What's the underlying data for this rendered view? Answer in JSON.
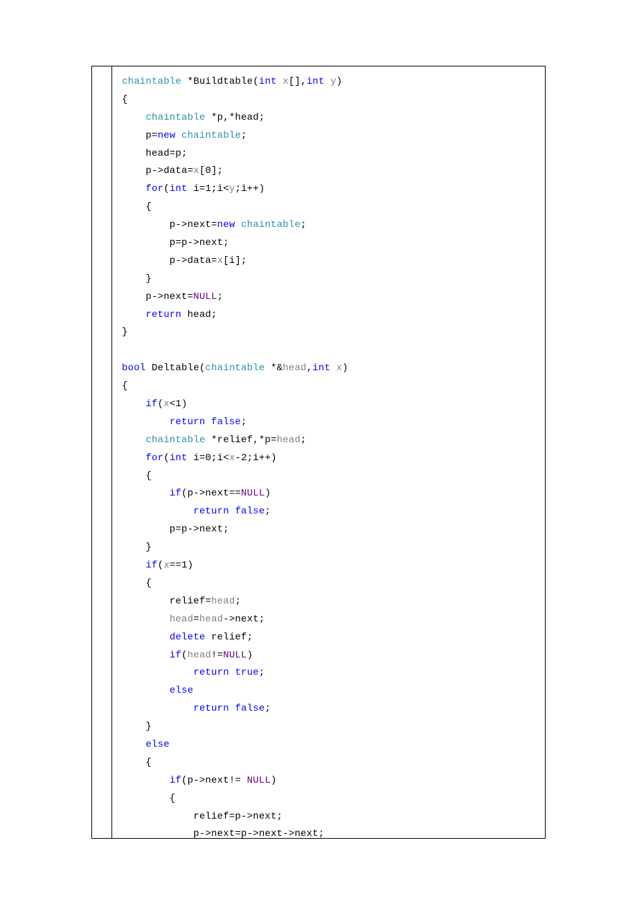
{
  "code": {
    "tokens": [
      {
        "cls": "t-type",
        "text": "chaintable"
      },
      {
        "cls": "",
        "text": " *Buildtable("
      },
      {
        "cls": "t-kw",
        "text": "int"
      },
      {
        "cls": "",
        "text": " "
      },
      {
        "cls": "t-param",
        "text": "x"
      },
      {
        "cls": "",
        "text": "[],"
      },
      {
        "cls": "t-kw",
        "text": "int"
      },
      {
        "cls": "",
        "text": " "
      },
      {
        "cls": "t-param",
        "text": "y"
      },
      {
        "cls": "",
        "text": ")"
      },
      {
        "nl": true
      },
      {
        "cls": "",
        "text": "{"
      },
      {
        "nl": true
      },
      {
        "cls": "",
        "text": "    "
      },
      {
        "cls": "t-type",
        "text": "chaintable"
      },
      {
        "cls": "",
        "text": " *p,*head;"
      },
      {
        "nl": true
      },
      {
        "cls": "",
        "text": "    p="
      },
      {
        "cls": "t-kw",
        "text": "new"
      },
      {
        "cls": "",
        "text": " "
      },
      {
        "cls": "t-type",
        "text": "chaintable"
      },
      {
        "cls": "",
        "text": ";"
      },
      {
        "nl": true
      },
      {
        "cls": "",
        "text": "    head=p;"
      },
      {
        "nl": true
      },
      {
        "cls": "",
        "text": "    p->data="
      },
      {
        "cls": "t-param",
        "text": "x"
      },
      {
        "cls": "",
        "text": "[0];"
      },
      {
        "nl": true
      },
      {
        "cls": "",
        "text": "    "
      },
      {
        "cls": "t-kw",
        "text": "for"
      },
      {
        "cls": "",
        "text": "("
      },
      {
        "cls": "t-kw",
        "text": "int"
      },
      {
        "cls": "",
        "text": " i=1;i<"
      },
      {
        "cls": "t-param",
        "text": "y"
      },
      {
        "cls": "",
        "text": ";i++)"
      },
      {
        "nl": true
      },
      {
        "cls": "",
        "text": "    {"
      },
      {
        "nl": true
      },
      {
        "cls": "",
        "text": "        p->next="
      },
      {
        "cls": "t-kw",
        "text": "new"
      },
      {
        "cls": "",
        "text": " "
      },
      {
        "cls": "t-type",
        "text": "chaintable"
      },
      {
        "cls": "",
        "text": ";"
      },
      {
        "nl": true
      },
      {
        "cls": "",
        "text": "        p=p->next;"
      },
      {
        "nl": true
      },
      {
        "cls": "",
        "text": "        p->data="
      },
      {
        "cls": "t-param",
        "text": "x"
      },
      {
        "cls": "",
        "text": "[i];"
      },
      {
        "nl": true
      },
      {
        "cls": "",
        "text": "    }"
      },
      {
        "nl": true
      },
      {
        "cls": "",
        "text": "    p->next="
      },
      {
        "cls": "t-null",
        "text": "NULL"
      },
      {
        "cls": "",
        "text": ";"
      },
      {
        "nl": true
      },
      {
        "cls": "",
        "text": "    "
      },
      {
        "cls": "t-kw",
        "text": "return"
      },
      {
        "cls": "",
        "text": " head;"
      },
      {
        "nl": true
      },
      {
        "cls": "",
        "text": "}"
      },
      {
        "nl": true
      },
      {
        "nl": true
      },
      {
        "cls": "t-kw",
        "text": "bool"
      },
      {
        "cls": "",
        "text": " Deltable("
      },
      {
        "cls": "t-type",
        "text": "chaintable"
      },
      {
        "cls": "",
        "text": " *&"
      },
      {
        "cls": "t-param",
        "text": "head"
      },
      {
        "cls": "",
        "text": ","
      },
      {
        "cls": "t-kw",
        "text": "int"
      },
      {
        "cls": "",
        "text": " "
      },
      {
        "cls": "t-param",
        "text": "x"
      },
      {
        "cls": "",
        "text": ")"
      },
      {
        "nl": true
      },
      {
        "cls": "",
        "text": "{"
      },
      {
        "nl": true
      },
      {
        "cls": "",
        "text": "    "
      },
      {
        "cls": "t-kw",
        "text": "if"
      },
      {
        "cls": "",
        "text": "("
      },
      {
        "cls": "t-param",
        "text": "x"
      },
      {
        "cls": "",
        "text": "<1)"
      },
      {
        "nl": true
      },
      {
        "cls": "",
        "text": "        "
      },
      {
        "cls": "t-kw",
        "text": "return"
      },
      {
        "cls": "",
        "text": " "
      },
      {
        "cls": "t-kw",
        "text": "false"
      },
      {
        "cls": "",
        "text": ";"
      },
      {
        "nl": true
      },
      {
        "cls": "",
        "text": "    "
      },
      {
        "cls": "t-type",
        "text": "chaintable"
      },
      {
        "cls": "",
        "text": " *relief,*p="
      },
      {
        "cls": "t-param",
        "text": "head"
      },
      {
        "cls": "",
        "text": ";"
      },
      {
        "nl": true
      },
      {
        "cls": "",
        "text": "    "
      },
      {
        "cls": "t-kw",
        "text": "for"
      },
      {
        "cls": "",
        "text": "("
      },
      {
        "cls": "t-kw",
        "text": "int"
      },
      {
        "cls": "",
        "text": " i=0;i<"
      },
      {
        "cls": "t-param",
        "text": "x"
      },
      {
        "cls": "",
        "text": "-2;i++)"
      },
      {
        "nl": true
      },
      {
        "cls": "",
        "text": "    {"
      },
      {
        "nl": true
      },
      {
        "cls": "",
        "text": "        "
      },
      {
        "cls": "t-kw",
        "text": "if"
      },
      {
        "cls": "",
        "text": "(p->next=="
      },
      {
        "cls": "t-null",
        "text": "NULL"
      },
      {
        "cls": "",
        "text": ")"
      },
      {
        "nl": true
      },
      {
        "cls": "",
        "text": "            "
      },
      {
        "cls": "t-kw",
        "text": "return"
      },
      {
        "cls": "",
        "text": " "
      },
      {
        "cls": "t-kw",
        "text": "false"
      },
      {
        "cls": "",
        "text": ";"
      },
      {
        "nl": true
      },
      {
        "cls": "",
        "text": "        p=p->next;"
      },
      {
        "nl": true
      },
      {
        "cls": "",
        "text": "    }"
      },
      {
        "nl": true
      },
      {
        "cls": "",
        "text": "    "
      },
      {
        "cls": "t-kw",
        "text": "if"
      },
      {
        "cls": "",
        "text": "("
      },
      {
        "cls": "t-param",
        "text": "x"
      },
      {
        "cls": "",
        "text": "==1)"
      },
      {
        "nl": true
      },
      {
        "cls": "",
        "text": "    {"
      },
      {
        "nl": true
      },
      {
        "cls": "",
        "text": "        relief="
      },
      {
        "cls": "t-param",
        "text": "head"
      },
      {
        "cls": "",
        "text": ";"
      },
      {
        "nl": true
      },
      {
        "cls": "",
        "text": "        "
      },
      {
        "cls": "t-param",
        "text": "head"
      },
      {
        "cls": "",
        "text": "="
      },
      {
        "cls": "t-param",
        "text": "head"
      },
      {
        "cls": "",
        "text": "->next;"
      },
      {
        "nl": true
      },
      {
        "cls": "",
        "text": "        "
      },
      {
        "cls": "t-kw",
        "text": "delete"
      },
      {
        "cls": "",
        "text": " relief;"
      },
      {
        "nl": true
      },
      {
        "cls": "",
        "text": "        "
      },
      {
        "cls": "t-kw",
        "text": "if"
      },
      {
        "cls": "",
        "text": "("
      },
      {
        "cls": "t-param",
        "text": "head"
      },
      {
        "cls": "",
        "text": "!="
      },
      {
        "cls": "t-null",
        "text": "NULL"
      },
      {
        "cls": "",
        "text": ")"
      },
      {
        "nl": true
      },
      {
        "cls": "",
        "text": "            "
      },
      {
        "cls": "t-kw",
        "text": "return"
      },
      {
        "cls": "",
        "text": " "
      },
      {
        "cls": "t-kw",
        "text": "true"
      },
      {
        "cls": "",
        "text": ";"
      },
      {
        "nl": true
      },
      {
        "cls": "",
        "text": "        "
      },
      {
        "cls": "t-kw",
        "text": "else"
      },
      {
        "nl": true
      },
      {
        "cls": "",
        "text": "            "
      },
      {
        "cls": "t-kw",
        "text": "return"
      },
      {
        "cls": "",
        "text": " "
      },
      {
        "cls": "t-kw",
        "text": "false"
      },
      {
        "cls": "",
        "text": ";"
      },
      {
        "nl": true
      },
      {
        "cls": "",
        "text": "    }"
      },
      {
        "nl": true
      },
      {
        "cls": "",
        "text": "    "
      },
      {
        "cls": "t-kw",
        "text": "else"
      },
      {
        "nl": true
      },
      {
        "cls": "",
        "text": "    {"
      },
      {
        "nl": true
      },
      {
        "cls": "",
        "text": "        "
      },
      {
        "cls": "t-kw",
        "text": "if"
      },
      {
        "cls": "",
        "text": "(p->next!= "
      },
      {
        "cls": "t-null",
        "text": "NULL"
      },
      {
        "cls": "",
        "text": ")"
      },
      {
        "nl": true
      },
      {
        "cls": "",
        "text": "        {"
      },
      {
        "nl": true
      },
      {
        "cls": "",
        "text": "            relief=p->next;"
      },
      {
        "nl": true
      },
      {
        "cls": "",
        "text": "            p->next=p->next->next;"
      }
    ]
  }
}
